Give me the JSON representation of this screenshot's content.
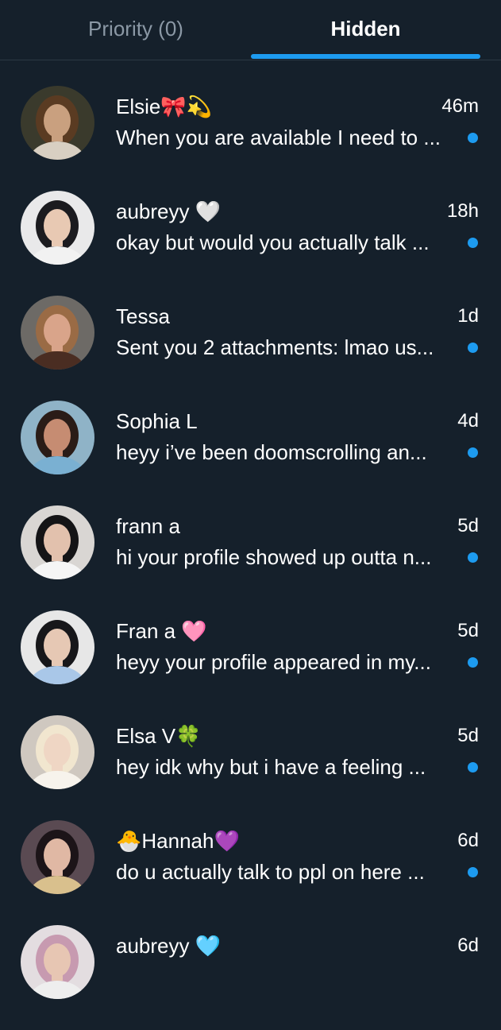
{
  "tabs": [
    {
      "label": "Priority (0)",
      "active": false
    },
    {
      "label": "Hidden",
      "active": true
    }
  ],
  "accent_color": "#1d9bf0",
  "conversations": [
    {
      "name": "Elsie🎀💫",
      "time": "46m",
      "preview": "When you are available I need to ...",
      "unread": true,
      "avatar": {
        "bg": "#3a3a2c",
        "skin": "#c9a07f",
        "hair": "#5a3b22",
        "top": "#d8cfc2"
      }
    },
    {
      "name": "aubreyy 🤍",
      "time": "18h",
      "preview": "okay but would you actually talk ...",
      "unread": true,
      "avatar": {
        "bg": "#e9e9ea",
        "skin": "#e8c9b3",
        "hair": "#1b1b1f",
        "top": "#f2f2f2"
      }
    },
    {
      "name": "Tessa",
      "time": "1d",
      "preview": "Sent you 2 attachments: lmao us...",
      "unread": true,
      "avatar": {
        "bg": "#6d6a66",
        "skin": "#d9a48a",
        "hair": "#9a6b45",
        "top": "#4a2d22"
      }
    },
    {
      "name": "Sophia L",
      "time": "4d",
      "preview": "heyy i’ve been doomscrolling an...",
      "unread": true,
      "avatar": {
        "bg": "#8fb3c7",
        "skin": "#c68c72",
        "hair": "#2a1c17",
        "top": "#7ab0d2"
      }
    },
    {
      "name": "frann a",
      "time": "5d",
      "preview": "hi your profile showed up outta n...",
      "unread": true,
      "avatar": {
        "bg": "#d9d6d3",
        "skin": "#e2c1ad",
        "hair": "#141416",
        "top": "#f5f5f5"
      }
    },
    {
      "name": "Fran a 🩷",
      "time": "5d",
      "preview": "heyy your profile appeared in my...",
      "unread": true,
      "avatar": {
        "bg": "#e7e7e7",
        "skin": "#e6c8b4",
        "hair": "#17171a",
        "top": "#a9c7e8"
      }
    },
    {
      "name": "Elsa V🍀",
      "time": "5d",
      "preview": "hey idk why but i have a feeling ...",
      "unread": true,
      "avatar": {
        "bg": "#cfc8c0",
        "skin": "#efd6c4",
        "hair": "#f1e6cf",
        "top": "#f7f3ec"
      }
    },
    {
      "name": "🐣Hannah💜",
      "time": "6d",
      "preview": "do u actually talk to ppl on here ...",
      "unread": true,
      "avatar": {
        "bg": "#5a4a52",
        "skin": "#e0b8a4",
        "hair": "#1c1418",
        "top": "#d9c08d"
      }
    },
    {
      "name": "aubreyy 🩵",
      "time": "6d",
      "preview": "",
      "unread": false,
      "avatar": {
        "bg": "#e3dde0",
        "skin": "#e7c6b3",
        "hair": "#c79ab0",
        "top": "#eeeeee"
      }
    }
  ]
}
